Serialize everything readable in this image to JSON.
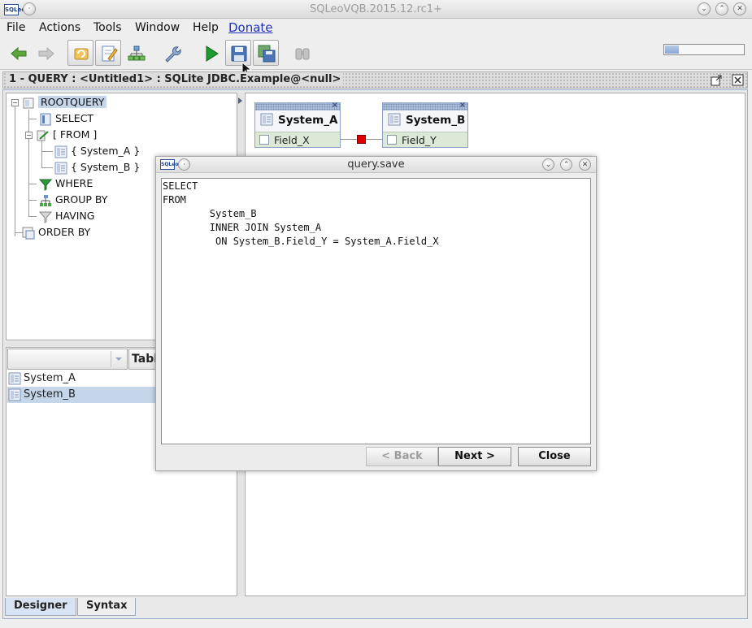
{
  "window": {
    "title": "SQLeoVQB.2015.12.rc1+",
    "logo_text": "SQLeo"
  },
  "menu": {
    "file": "File",
    "actions": "Actions",
    "tools": "Tools",
    "window": "Window",
    "help": "Help",
    "donate": "Donate"
  },
  "toolbar": {
    "icons": [
      "arrow-left-icon",
      "arrow-right-icon",
      "reload-icon",
      "edit-icon",
      "hierarchy-icon",
      "wrench-icon",
      "run-icon",
      "save-icon",
      "save-as-icon",
      "binoculars-icon"
    ],
    "memory_used_fraction": 0.18
  },
  "query_tab": {
    "title": "1 - QUERY : <Untitled1> : SQLite JDBC.Example@<null>"
  },
  "tree": {
    "root": "ROOTQUERY",
    "select": "SELECT",
    "from": "[ FROM ]",
    "table_a": "{ System_A }",
    "table_b": "{ System_B }",
    "where": "WHERE",
    "group_by": "GROUP BY",
    "having": "HAVING",
    "order_by": "ORDER BY"
  },
  "table_list": {
    "filter_value": "",
    "type_label": "Table",
    "rows": [
      "System_A",
      "System_B"
    ],
    "selected_index": 1
  },
  "diagram": {
    "entity_a": {
      "name": "System_A",
      "field": "Field_X"
    },
    "entity_b": {
      "name": "System_B",
      "field": "Field_Y"
    },
    "close_glyph": "×"
  },
  "bottom_tabs": {
    "designer": "Designer",
    "syntax": "Syntax",
    "active": "designer"
  },
  "dialog": {
    "title": "query.save",
    "logo_text": "SQLeo",
    "sql_text": "SELECT\nFROM\n        System_B\n        INNER JOIN System_A\n         ON System_B.Field_Y = System_A.Field_X",
    "back_label": "< Back",
    "next_label": "Next >",
    "close_label": "Close"
  }
}
